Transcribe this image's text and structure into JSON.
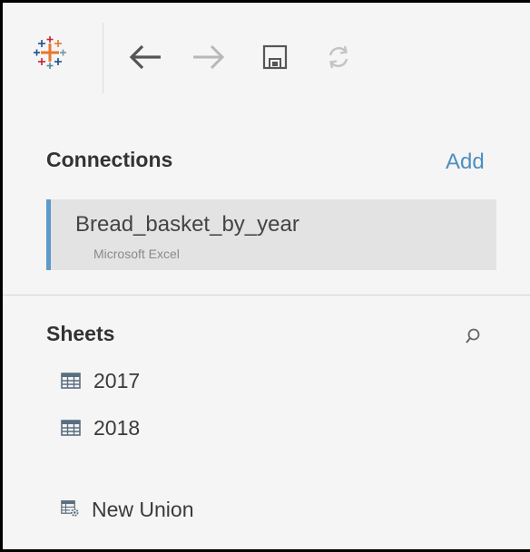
{
  "toolbar": {
    "icons": [
      "tableau-logo-icon",
      "back-arrow-icon",
      "forward-arrow-icon",
      "save-icon",
      "refresh-icon"
    ]
  },
  "connections": {
    "title": "Connections",
    "add_label": "Add",
    "items": [
      {
        "name": "Bread_basket_by_year",
        "type": "Microsoft Excel"
      }
    ]
  },
  "sheets": {
    "title": "Sheets",
    "items": [
      {
        "label": "2017",
        "icon": "table-icon"
      },
      {
        "label": "2018",
        "icon": "table-icon"
      }
    ],
    "new_union": {
      "label": "New Union",
      "icon": "new-union-icon"
    }
  },
  "colors": {
    "accent": "#4d8fc0",
    "selection_bar": "#5b9bc9",
    "panel_bg": "#f5f5f5",
    "item_bg": "#e3e3e3",
    "logo_blue": "#1f4e91",
    "logo_orange": "#e8762b",
    "logo_red": "#c72037",
    "logo_teal": "#59879b"
  }
}
